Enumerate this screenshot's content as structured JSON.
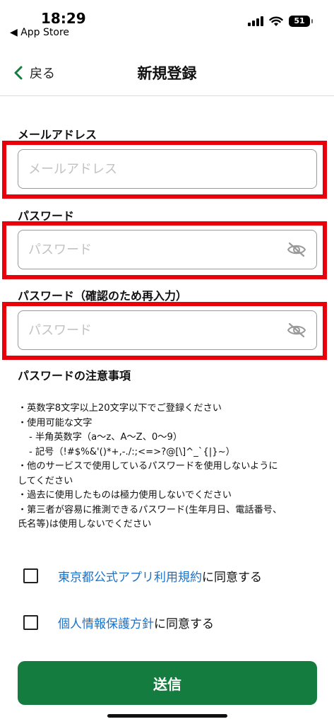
{
  "status_bar": {
    "time": "18:29",
    "back_app": "◀ App Store",
    "battery": "51"
  },
  "nav": {
    "back_label": "戻る",
    "title": "新規登録"
  },
  "form": {
    "email": {
      "label": "メールアドレス",
      "placeholder": "メールアドレス",
      "value": ""
    },
    "password": {
      "label": "パスワード",
      "placeholder": "パスワード",
      "value": ""
    },
    "password_confirm": {
      "label": "パスワード（確認のため再入力）",
      "placeholder": "パスワード",
      "value": ""
    }
  },
  "notes": {
    "title": "パスワードの注意事項",
    "lines": [
      "・英数字8文字以上20文字以下でご登録ください",
      "・使用可能な文字",
      "- 半角英数字（a〜z、A〜Z、0〜9）",
      "- 記号（!#$%&'()*+,-./:;<=>?@[\\]^_`{|}~）",
      "・他のサービスで使用しているパスワードを使用しないように",
      "してください",
      "・過去に使用したものは極力使用しないでください",
      "・第三者が容易に推測できるパスワード(生年月日、電話番号、",
      "氏名等)は使用しないでください"
    ]
  },
  "agreements": {
    "terms": {
      "link": "東京都公式アプリ利用規約",
      "suffix": "に同意する",
      "checked": false
    },
    "privacy": {
      "link": "個人情報保護方針",
      "suffix": "に同意する",
      "checked": false
    }
  },
  "submit_label": "送信",
  "colors": {
    "brand_green": "#137c3e",
    "highlight_red": "#e8000b",
    "link_blue": "#1a73c8"
  }
}
